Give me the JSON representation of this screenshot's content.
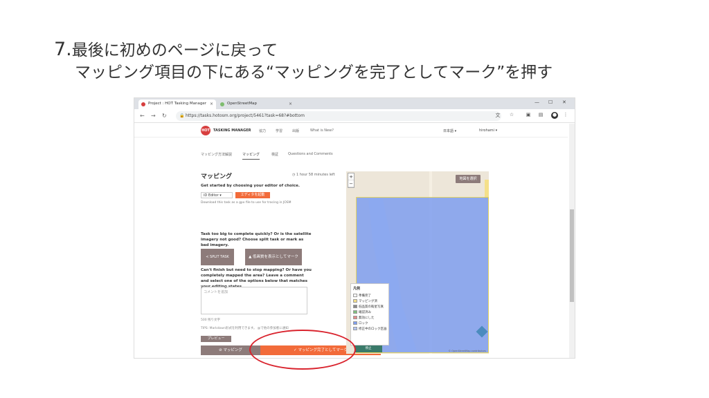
{
  "slide": {
    "step_number": "7.",
    "title_line1": "最後に初めのページに戻って",
    "title_line2": "マッピング項目の下にある“マッピングを完了としてマーク”を押す"
  },
  "browser": {
    "tabs": [
      {
        "label": "Project : HOT Tasking Manager",
        "close": "×"
      },
      {
        "label": "OpenStreetMap",
        "close": "×"
      }
    ],
    "url": "https://tasks.hotosm.org/project/5461?task=68?#bottom",
    "window_controls": {
      "minimize": "—",
      "maximize": "☐",
      "close": "✕"
    },
    "nav": {
      "back": "←",
      "forward": "→",
      "reload": "↻"
    }
  },
  "app": {
    "brand": "TASKING MANAGER",
    "nav_links": [
      "協力",
      "学習",
      "出版",
      "What is New?"
    ],
    "language": "日本語 ▾",
    "user": "hirohami ▾"
  },
  "subtabs": [
    "マッピング方法解説",
    "マッピング",
    "検証",
    "Questions and Comments"
  ],
  "mapping": {
    "heading": "マッピング",
    "timer": "◷ 1 hour 58 minutes left",
    "subtext": "Get started by choosing your editor of choice.",
    "editor_select": "iD Editor ▾",
    "start_button": "エディタを起動",
    "download_text": "Download this task as a gpx file to use for tracing in JOSM",
    "question1": "Task too big to complete quickly? Or is the satellite imagery not good? Choose split task or mark as bad imagery.",
    "split_button": "≺ SPLIT TASK",
    "bad_imagery_button": "▲ 低画質を表示としてマーク",
    "question2": "Can't finish but need to stop mapping? Or have you completely mapped the area? Leave a comment and select one of the options below that matches your editing states.",
    "comment_placeholder": "コメントを追加",
    "chars_left": "500 残り文字",
    "tips": "TIPS: Markdown形式を利用できます。 @で他の参加者に通知",
    "preview_button": "プレビュー",
    "mapping_button": "⊘ マッピング",
    "done_button": "✓ マッピング完了としてマーク",
    "stop_button": "停止"
  },
  "map": {
    "top_button": "地図を選択",
    "zoom_in": "+",
    "zoom_out": "−",
    "legend_title": "凡例",
    "legend": [
      {
        "label": "準備完了",
        "color": "#ffffff"
      },
      {
        "label": "マッピング済",
        "color": "#f5e08a"
      },
      {
        "label": "低品質の衛星写真",
        "color": "#888888"
      },
      {
        "label": "確認済み",
        "color": "#7fbf7f"
      },
      {
        "label": "無効にした",
        "color": "#e48a8a"
      },
      {
        "label": "ロック",
        "color": "#7f9ff0"
      },
      {
        "label": "修正中のロック区画",
        "color": "#b3c6f5"
      }
    ],
    "attribution": "© OpenStreetMap contributors"
  },
  "colors": {
    "accent": "#f26b3a",
    "secondary": "#8d7b7a",
    "task_fill": "#7f9ff0",
    "highlight": "#d9232d"
  }
}
